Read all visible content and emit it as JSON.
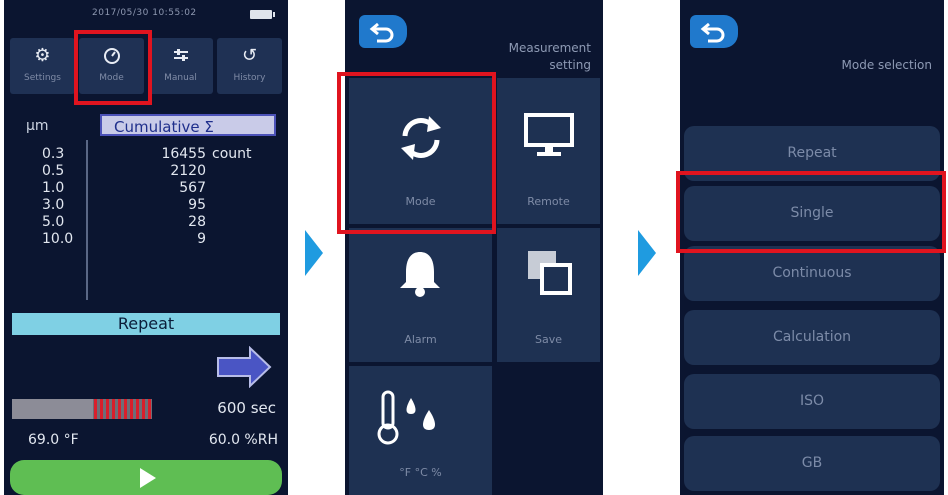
{
  "screen1": {
    "datetime": "2017/05/30 10:55:02",
    "tabs": [
      {
        "label": "Settings",
        "icon": "gear-icon"
      },
      {
        "label": "Mode",
        "icon": "gauge-icon"
      },
      {
        "label": "Manual",
        "icon": "sliders-icon"
      },
      {
        "label": "History",
        "icon": "history-icon"
      }
    ],
    "unit": "µm",
    "cumulative_label": "Cumulative Σ",
    "rows": [
      {
        "size": "0.3",
        "count": "16455",
        "unit": "count"
      },
      {
        "size": "0.5",
        "count": "2120",
        "unit": ""
      },
      {
        "size": "1.0",
        "count": "567",
        "unit": ""
      },
      {
        "size": "3.0",
        "count": "95",
        "unit": ""
      },
      {
        "size": "5.0",
        "count": "28",
        "unit": ""
      },
      {
        "size": "10.0",
        "count": "9",
        "unit": ""
      }
    ],
    "mode_label": "Repeat",
    "next_button_icon": "arrow-right-icon",
    "time_label": "600 sec",
    "temperature": "69.0 °F",
    "humidity": "60.0 %RH",
    "progress": 0.58,
    "start_icon": "play-icon"
  },
  "screen2": {
    "title_line1": "Measurement",
    "title_line2": "setting",
    "tiles": [
      {
        "label": "Mode",
        "icon": "refresh-icon"
      },
      {
        "label": "Remote",
        "icon": "monitor-icon"
      },
      {
        "label": "Alarm",
        "icon": "bell-icon"
      },
      {
        "label": "Save",
        "icon": "copy-icon"
      },
      {
        "label": "°F °C %",
        "icon": "thermometer-drops-icon"
      }
    ]
  },
  "screen3": {
    "title": "Mode selection",
    "options": [
      "Repeat",
      "Single",
      "Continuous",
      "Calculation",
      "ISO",
      "GB"
    ]
  },
  "colors": {
    "screen_bg": "#0b1530",
    "tile_bg": "#1e3152",
    "highlight": "#e0141f",
    "flow_arrow": "#1f9be0",
    "start_button": "#5fbe53",
    "mode_bar": "#7fd0e4"
  }
}
